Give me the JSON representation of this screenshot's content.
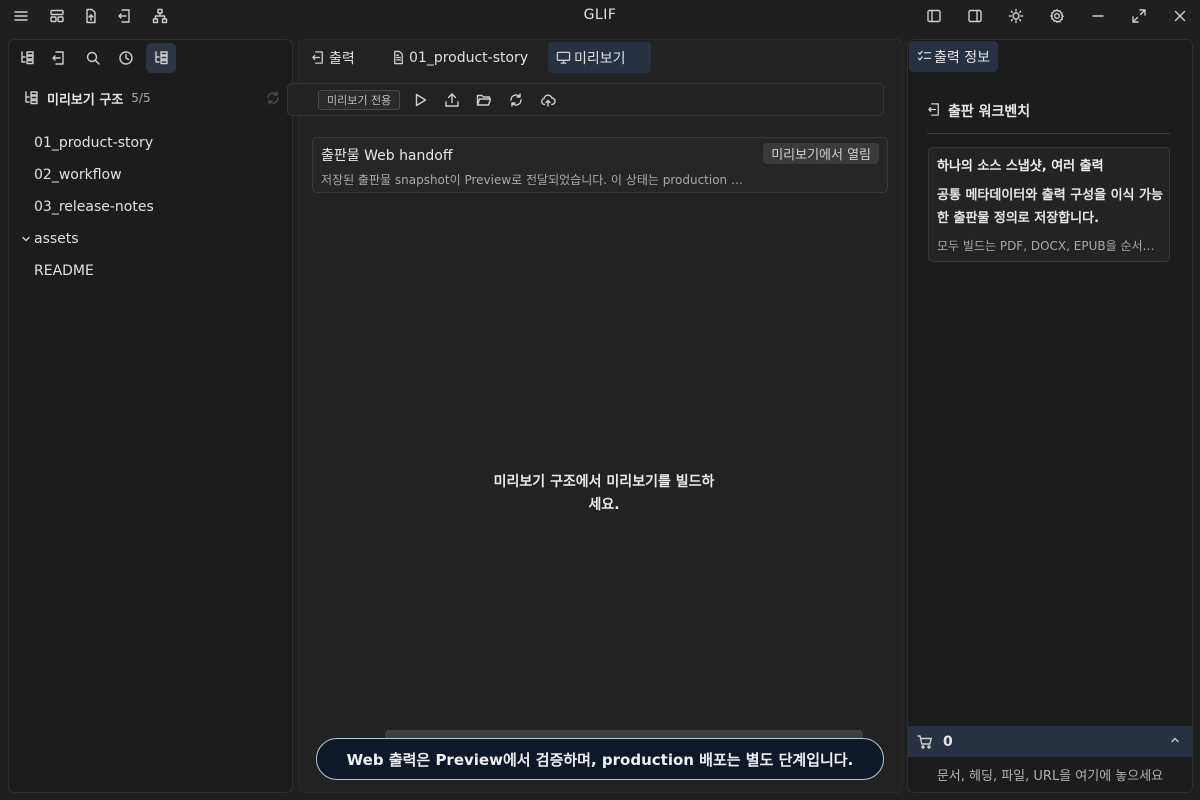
{
  "app": {
    "title": "GLIF"
  },
  "left": {
    "tree": {
      "title": "미리보기 구조",
      "count": "5/5",
      "items": [
        "01_product-story",
        "02_workflow",
        "03_release-notes",
        "assets",
        "README"
      ]
    }
  },
  "center": {
    "tabs": [
      {
        "label": "출력",
        "icon": "export-icon"
      },
      {
        "label": "01_product-story",
        "icon": "document-icon"
      },
      {
        "label": "미리보기",
        "icon": "monitor-icon"
      }
    ],
    "toolbar": {
      "badge": "미리보기 전용"
    },
    "card": {
      "title": "출판물 Web handoff",
      "badge": "미리보기에서 열림",
      "description": "저장된 출판물 snapshot이 Preview로 전달되었습니다. 이 상태는 production 배포 완..."
    },
    "empty_message": "미리보기 구조에서 미리보기를 빌드하세요."
  },
  "right": {
    "tab_label": "출력 정보",
    "workbench_title": "출판 워크벤치",
    "card": {
      "title": "하나의 소스 스냅샷, 여러 출력",
      "body": "공통 메타데이터와 출력 구성을 이식 가능한 출판물 정의로 저장합니다.",
      "footer": "모두 빌드는 PDF, DOCX, EPUB을 순서대로 ..."
    },
    "cart_count": "0",
    "drop_hint": "문서, 헤딩, 파일, URL을 여기에 놓으세요"
  },
  "toast": {
    "message": "Web 출력은 Preview에서 검증하며, production 배포는 별도 단계입니다."
  },
  "colors": {
    "accent_bg": "#283140",
    "toast_border": "#b9c6d6",
    "toast_bg": "#0e1827"
  }
}
